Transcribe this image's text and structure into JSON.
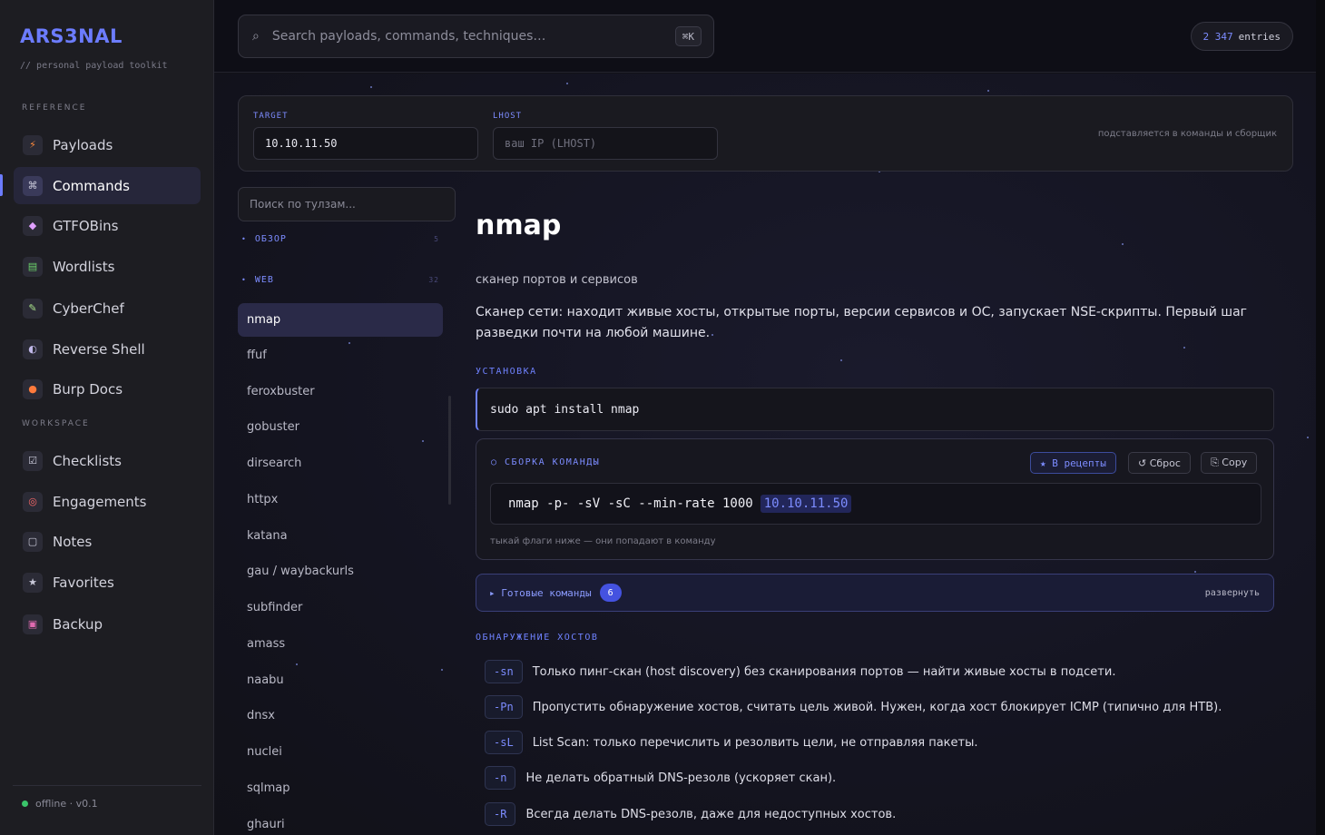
{
  "app": {
    "brand": "ARS3NAL",
    "tagline": "// personal payload toolkit",
    "status": "offline · v0.1"
  },
  "sidebar": {
    "reference_label": "REFERENCE",
    "workspace_label": "WORKSPACE",
    "reference_items": [
      {
        "label": "Payloads",
        "icon": "⚡"
      },
      {
        "label": "Commands",
        "icon": "⌘"
      },
      {
        "label": "GTFOBins",
        "icon": "◆"
      },
      {
        "label": "Wordlists",
        "icon": "▤"
      },
      {
        "label": "CyberChef",
        "icon": "✎"
      },
      {
        "label": "Reverse Shell",
        "icon": "◐"
      },
      {
        "label": "Burp Docs",
        "icon": "●"
      }
    ],
    "workspace_items": [
      {
        "label": "Checklists",
        "icon": "☑"
      },
      {
        "label": "Engagements",
        "icon": "◎"
      },
      {
        "label": "Notes",
        "icon": "▢"
      },
      {
        "label": "Favorites",
        "icon": "★"
      },
      {
        "label": "Backup",
        "icon": "▣"
      }
    ]
  },
  "topbar": {
    "search_placeholder": "Search payloads, commands, techniques…",
    "shortcut": "⌘K",
    "entries_count": "2 347",
    "entries_label": "entries"
  },
  "vars": {
    "target_label": "TARGET",
    "target_value": "10.10.11.50",
    "lhost_label": "LHOST",
    "lhost_placeholder": "ваш IP (LHOST)",
    "hint": "подставляется в команды и сборщик"
  },
  "tools": {
    "search_placeholder": "Поиск по тулзам...",
    "groups": [
      {
        "label": "ОБЗОР",
        "count": "5"
      },
      {
        "label": "WEB",
        "count": "32"
      }
    ],
    "items": [
      "nmap",
      "ffuf",
      "feroxbuster",
      "gobuster",
      "dirsearch",
      "httpx",
      "katana",
      "gau / waybackurls",
      "subfinder",
      "amass",
      "naabu",
      "dnsx",
      "nuclei",
      "sqlmap",
      "ghauri"
    ],
    "active": "nmap"
  },
  "detail": {
    "title": "nmap",
    "subtitle": "сканер портов и сервисов",
    "description": "Сканер сети: находит живые хосты, открытые порты, версии сервисов и ОС, запускает NSE-скрипты. Первый шаг разведки почти на любой машине.",
    "install_label": "УСТАНОВКА",
    "install_cmd": "sudo apt install nmap",
    "builder": {
      "title": "○ СБОРКА КОМАНДЫ",
      "recipes_btn": "★ В рецепты",
      "reset_btn": "↺ Сброс",
      "copy_btn": "⎘ Copy",
      "command": "nmap -p- -sV -sC --min-rate 1000",
      "target": "10.10.11.50",
      "hint": "тыкай флаги ниже — они попадают в команду"
    },
    "ready": {
      "label": "▸ Готовые команды",
      "count": "6",
      "expand": "развернуть"
    },
    "flags_section": "ОБНАРУЖЕНИЕ ХОСТОВ",
    "flags": [
      {
        "flag": "-sn",
        "desc": "Только пинг-скан (host discovery) без сканирования портов — найти живые хосты в подсети."
      },
      {
        "flag": "-Pn",
        "desc": "Пропустить обнаружение хостов, считать цель живой. Нужен, когда хост блокирует ICMP (типично для HTB)."
      },
      {
        "flag": "-sL",
        "desc": "List Scan: только перечислить и резолвить цели, не отправляя пакеты."
      },
      {
        "flag": "-n",
        "desc": "Не делать обратный DNS-резолв (ускоряет скан)."
      },
      {
        "flag": "-R",
        "desc": "Всегда делать DNS-резолв, даже для недоступных хостов."
      }
    ]
  },
  "colors": {
    "accent": "#6c7cff",
    "background": "#121218",
    "sidebar": "#1d1d22",
    "status_online": "#3ac46a"
  }
}
